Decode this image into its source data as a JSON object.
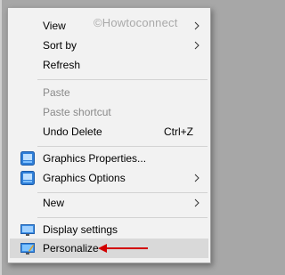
{
  "watermark": "©Howtoconnect",
  "menu": {
    "items": [
      {
        "label": "View"
      },
      {
        "label": "Sort by"
      },
      {
        "label": "Refresh"
      },
      {
        "label": "Paste"
      },
      {
        "label": "Paste shortcut"
      },
      {
        "label": "Undo Delete",
        "shortcut": "Ctrl+Z"
      },
      {
        "label": "Graphics Properties..."
      },
      {
        "label": "Graphics Options"
      },
      {
        "label": "New"
      },
      {
        "label": "Display settings"
      },
      {
        "label": "Personalize"
      }
    ]
  },
  "icons": {
    "graphics_properties": "intel-graphics-icon",
    "graphics_options": "intel-graphics-icon",
    "display_settings": "display-monitor-icon",
    "personalize": "personalize-monitor-brush-icon"
  },
  "colors": {
    "annotation_arrow": "#d20000",
    "menu_background": "#f2f2f2",
    "hover_background": "#d9d9d9"
  }
}
